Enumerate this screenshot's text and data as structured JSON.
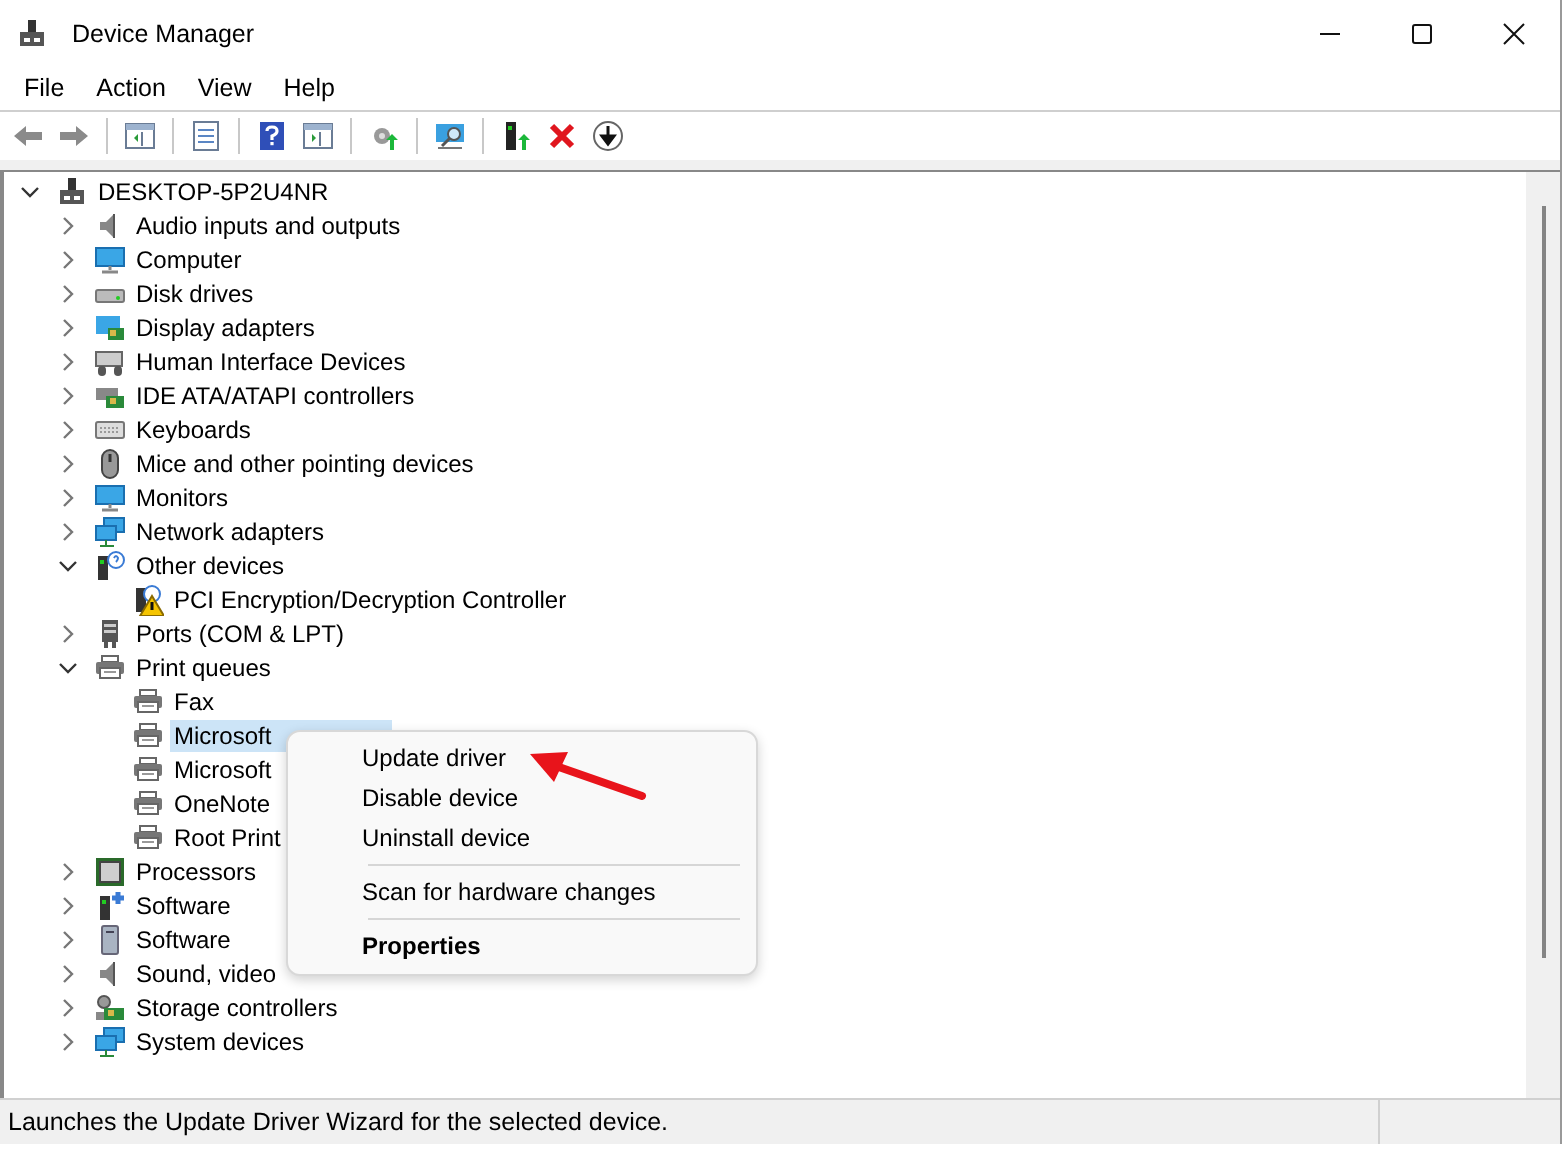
{
  "window": {
    "title": "Device Manager"
  },
  "menu_bar": [
    "File",
    "Action",
    "View",
    "Help"
  ],
  "tree": {
    "label": "DESKTOP-5P2U4NR",
    "kind": "computer-root",
    "expanded": true,
    "children": [
      {
        "label": "Audio inputs and outputs",
        "kind": "speaker",
        "expanded": false
      },
      {
        "label": "Computer",
        "kind": "monitor",
        "expanded": false
      },
      {
        "label": "Disk drives",
        "kind": "disk",
        "expanded": false
      },
      {
        "label": "Display adapters",
        "kind": "display",
        "expanded": false
      },
      {
        "label": "Human Interface Devices",
        "kind": "hid",
        "expanded": false
      },
      {
        "label": "IDE ATA/ATAPI controllers",
        "kind": "card",
        "expanded": false
      },
      {
        "label": "Keyboards",
        "kind": "keyboard",
        "expanded": false
      },
      {
        "label": "Mice and other pointing devices",
        "kind": "mouse",
        "expanded": false
      },
      {
        "label": "Monitors",
        "kind": "monitor",
        "expanded": false
      },
      {
        "label": "Network adapters",
        "kind": "network",
        "expanded": false
      },
      {
        "label": "Other devices",
        "kind": "unknown",
        "expanded": true,
        "children": [
          {
            "label": "PCI Encryption/Decryption Controller",
            "kind": "warning",
            "selected": false
          }
        ]
      },
      {
        "label": "Ports (COM & LPT)",
        "kind": "port",
        "expanded": false
      },
      {
        "label": "Print queues",
        "kind": "printer",
        "expanded": true,
        "children": [
          {
            "label": "Fax",
            "kind": "printer",
            "selected": false
          },
          {
            "label": "Microsoft",
            "kind": "printer",
            "selected": true
          },
          {
            "label": "Microsoft",
            "kind": "printer",
            "selected": false
          },
          {
            "label": "OneNote",
            "kind": "printer",
            "selected": false
          },
          {
            "label": "Root Print",
            "kind": "printer",
            "selected": false
          }
        ]
      },
      {
        "label": "Processors",
        "kind": "chip",
        "expanded": false
      },
      {
        "label": "Software",
        "kind": "software",
        "expanded": false
      },
      {
        "label": "Software",
        "kind": "tower",
        "expanded": false
      },
      {
        "label": "Sound, video",
        "kind": "speaker",
        "expanded": false
      },
      {
        "label": "Storage controllers",
        "kind": "storage",
        "expanded": false
      },
      {
        "label": "System devices",
        "kind": "network",
        "expanded": false
      }
    ]
  },
  "context_menu": [
    {
      "kind": "item",
      "label": "Update driver",
      "default": false
    },
    {
      "kind": "item",
      "label": "Disable device",
      "default": false
    },
    {
      "kind": "item",
      "label": "Uninstall device",
      "default": false
    },
    {
      "kind": "separator"
    },
    {
      "kind": "item",
      "label": "Scan for hardware changes",
      "default": false
    },
    {
      "kind": "separator"
    },
    {
      "kind": "item",
      "label": "Properties",
      "default": true
    }
  ],
  "status_bar": "Launches the Update Driver Wizard for the selected device."
}
